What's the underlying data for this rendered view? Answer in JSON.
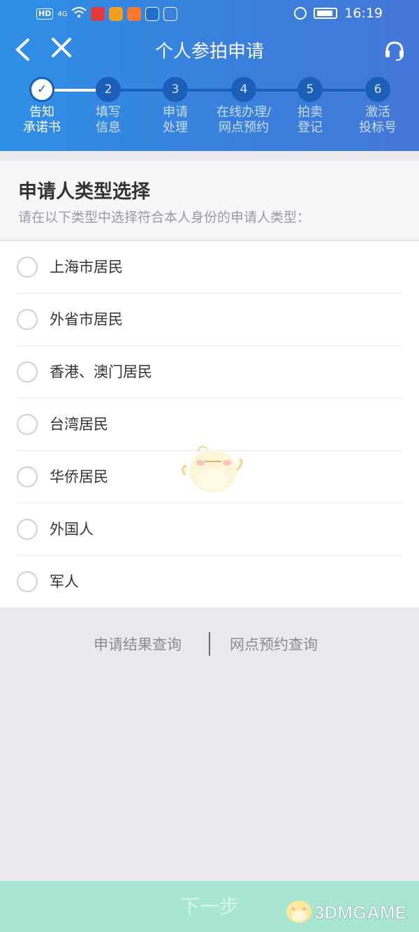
{
  "status_bar": {
    "hd": "HD",
    "signal": "4G",
    "time": "16:19"
  },
  "nav": {
    "back_icon": "‹",
    "close_icon": "✕",
    "title": "个人参拍申请"
  },
  "steps": [
    {
      "number": "✓",
      "line1": "告知",
      "line2": "承诺书",
      "active": true
    },
    {
      "number": "2",
      "line1": "填写",
      "line2": "信息",
      "active": false
    },
    {
      "number": "3",
      "line1": "申请",
      "line2": "处理",
      "active": false
    },
    {
      "number": "4",
      "line1": "在线办理/",
      "line2": "网点预约",
      "active": false
    },
    {
      "number": "5",
      "line1": "拍卖",
      "line2": "登记",
      "active": false
    },
    {
      "number": "6",
      "line1": "激活",
      "line2": "投标号",
      "active": false
    }
  ],
  "section": {
    "title": "申请人类型选择",
    "subtitle": "请在以下类型中选择符合本人身份的申请人类型："
  },
  "options": [
    "上海市居民",
    "外省市居民",
    "香港、澳门居民",
    "台湾居民",
    "华侨居民",
    "外国人",
    "军人"
  ],
  "links": {
    "result_query": "申请结果查询",
    "appointment_query": "网点预约查询"
  },
  "next_button": "下一步",
  "watermark": {
    "logo_text": "3DMGAME"
  },
  "colors": {
    "header_blue": "#3a84e0",
    "step_dark": "#1b5fb8",
    "next_button": "#a9e6d2"
  }
}
